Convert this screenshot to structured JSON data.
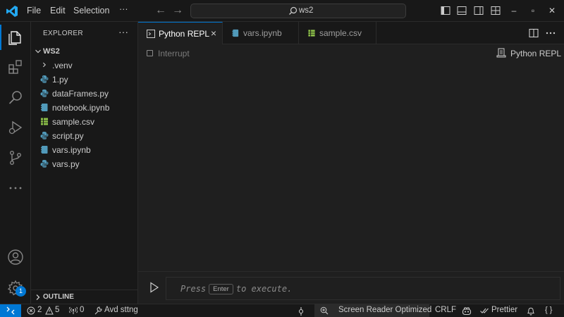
{
  "menu": {
    "file": "File",
    "edit": "Edit",
    "selection": "Selection",
    "more": "···"
  },
  "search": {
    "text": "ws2"
  },
  "colors": {
    "accent": "#0078d4",
    "python": "#519aba",
    "csv": "#8dc149",
    "background": "#181818",
    "editor": "#1f1f1f"
  },
  "sidebar": {
    "title": "EXPLORER",
    "more": "···",
    "folder": "WS2",
    "items": [
      {
        "label": ".venv",
        "icon": "chevron-right-icon"
      },
      {
        "label": "1.py",
        "icon": "python-file-icon"
      },
      {
        "label": "dataFrames.py",
        "icon": "python-file-icon"
      },
      {
        "label": "notebook.ipynb",
        "icon": "notebook-file-icon"
      },
      {
        "label": "sample.csv",
        "icon": "csv-file-icon"
      },
      {
        "label": "script.py",
        "icon": "python-file-icon"
      },
      {
        "label": "vars.ipynb",
        "icon": "notebook-file-icon"
      },
      {
        "label": "vars.py",
        "icon": "python-file-icon"
      }
    ],
    "outline": "OUTLINE"
  },
  "activity": {
    "settings_badge": "1"
  },
  "tabs": [
    {
      "label": "Python REPL",
      "active": true
    },
    {
      "label": "vars.ipynb",
      "active": false
    },
    {
      "label": "sample.csv",
      "active": false
    }
  ],
  "editor": {
    "interrupt": "Interrupt",
    "kernel": "Python REPL"
  },
  "input": {
    "press": "Press",
    "key": "Enter",
    "execute": "to execute."
  },
  "status": {
    "errors": "2",
    "warnings": "5",
    "ports": "0",
    "avd": "Avd sttng",
    "screen_reader": "Screen Reader Optimized",
    "eol": "CRLF",
    "prettier": "Prettier",
    "braces": "{ }"
  }
}
